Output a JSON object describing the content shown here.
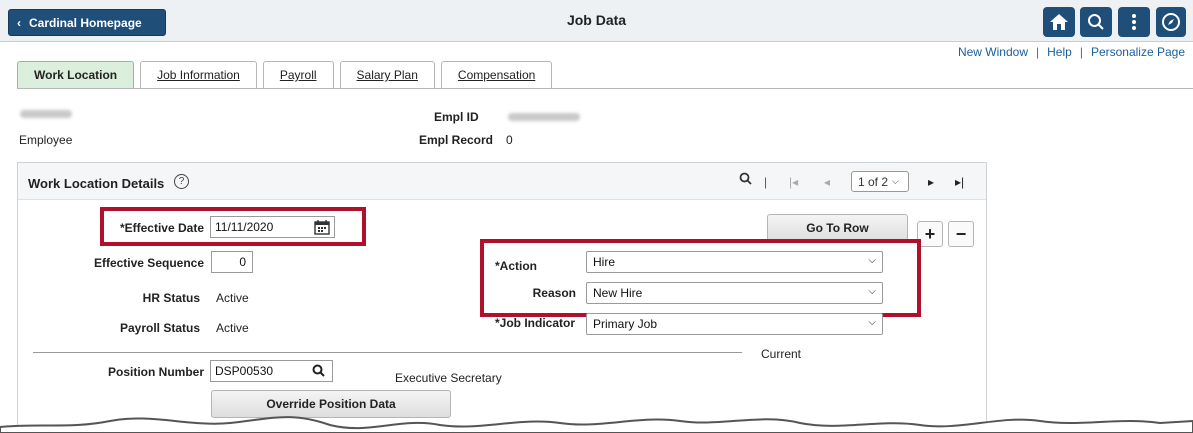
{
  "header": {
    "back_label": "Cardinal Homepage",
    "title": "Job Data",
    "icons": [
      "home-icon",
      "search-icon",
      "more-actions-icon",
      "navbar-compass-icon"
    ]
  },
  "toplinks": {
    "new_window": "New Window",
    "help": "Help",
    "personalize": "Personalize Page",
    "separator": "|"
  },
  "tabs": [
    {
      "label": "Work Location",
      "active": true
    },
    {
      "label": "Job Information",
      "active": false
    },
    {
      "label": "Payroll",
      "active": false
    },
    {
      "label": "Salary Plan",
      "active": false
    },
    {
      "label": "Compensation",
      "active": false
    }
  ],
  "employee": {
    "employee_label": "Employee",
    "empl_id_label": "Empl ID",
    "empl_record_label": "Empl Record",
    "empl_record_value": "0"
  },
  "panel": {
    "title": "Work Location Details",
    "pagination": "1 of 2",
    "go_to_row": "Go To Row",
    "add": "+",
    "remove": "−"
  },
  "fields": {
    "effective_date_label": "*Effective Date",
    "effective_date_value": "11/11/2020",
    "effective_sequence_label": "Effective Sequence",
    "effective_sequence_value": "0",
    "hr_status_label": "HR Status",
    "hr_status_value": "Active",
    "payroll_status_label": "Payroll Status",
    "payroll_status_value": "Active",
    "action_label": "*Action",
    "action_value": "Hire",
    "reason_label": "Reason",
    "reason_value": "New Hire",
    "job_indicator_label": "*Job Indicator",
    "job_indicator_value": "Primary Job",
    "current_label": "Current",
    "position_number_label": "Position Number",
    "position_number_value": "DSP00530",
    "position_title": "Executive Secretary",
    "override_button": "Override Position Data"
  },
  "colors": {
    "header_button": "#1f4e79",
    "highlight": "#b0102c",
    "active_tab": "#dcefdc"
  }
}
